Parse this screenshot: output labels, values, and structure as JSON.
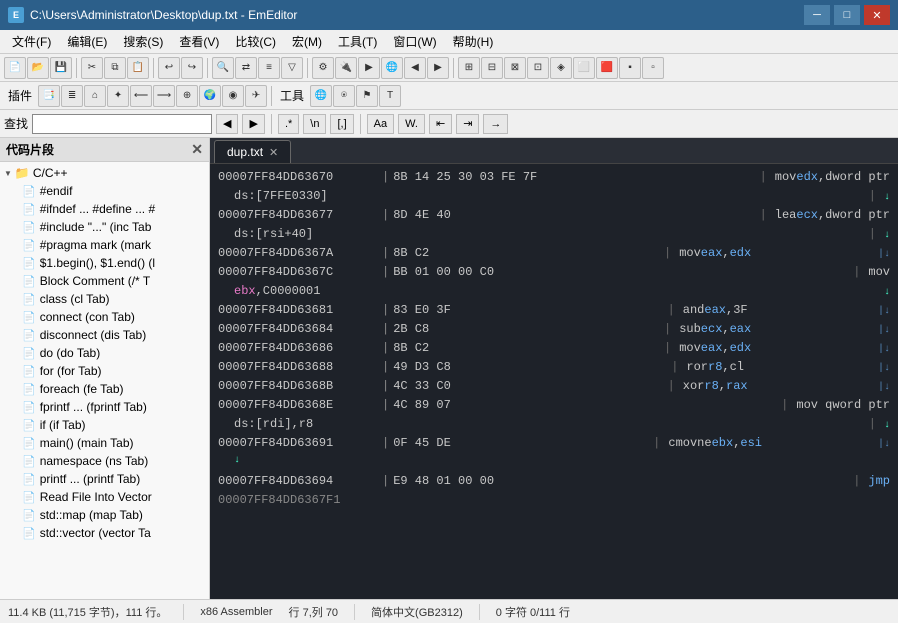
{
  "titlebar": {
    "title": "C:\\Users\\Administrator\\Desktop\\dup.txt - EmEditor",
    "icon_label": "E",
    "minimize_label": "─",
    "maximize_label": "□",
    "close_label": "✕"
  },
  "menubar": {
    "items": [
      "文件(F)",
      "编辑(E)",
      "搜索(S)",
      "查看(V)",
      "比较(C)",
      "宏(M)",
      "工具(T)",
      "窗口(W)",
      "帮助(H)"
    ]
  },
  "find_bar": {
    "label": "查找",
    "placeholder": ""
  },
  "sidebar": {
    "title": "代码片段",
    "tree_root_label": "C/C++",
    "items": [
      "#endif",
      "#ifndef ... #define ... #",
      "#include \"...\" (inc Tab",
      "#pragma mark (mark",
      "$1.begin(), $1.end() (l",
      "Block Comment (/* T",
      "class (cl Tab)",
      "connect (con Tab)",
      "disconnect (dis Tab)",
      "do (do Tab)",
      "for (for Tab)",
      "foreach (fe Tab)",
      "fprintf ... (fprintf Tab)",
      "if (if Tab)",
      "main() (main Tab)",
      "namespace (ns Tab)",
      "printf ... (printf Tab)",
      "Read File Into Vector",
      "std::map (map Tab)",
      "std::vector (vector Ta"
    ]
  },
  "editor": {
    "tab_name": "dup.txt",
    "lines": [
      {
        "addr": "00007FF84DD63670",
        "bytes": "8B 14 25 30 03 FE 7F",
        "spaces": "            ",
        "pipe": "|",
        "mnemonic": " mov ",
        "reg1": "edx",
        "op": ",dword ptr",
        "indent": ""
      },
      {
        "addr": "ds:[7FFE0330]",
        "bytes": "",
        "spaces": "",
        "pipe": "|↓",
        "mnemonic": "",
        "reg1": "",
        "op": "",
        "indent": ""
      },
      {
        "addr": "00007FF84DD63677",
        "bytes": "8D 4E 40",
        "spaces": "                   ",
        "pipe": "|",
        "mnemonic": " lea ",
        "reg1": "ecx",
        "op": ",dword ptr",
        "indent": ""
      },
      {
        "addr": "ds:[rsi+40]",
        "bytes": "",
        "spaces": "        ",
        "pipe": "|↓",
        "mnemonic": "",
        "reg1": "",
        "op": "",
        "indent": ""
      },
      {
        "addr": "00007FF84DD6367A",
        "bytes": "8B C2",
        "spaces": "                     ",
        "pipe": "|",
        "mnemonic": " mov ",
        "reg1": "eax",
        "op": ",",
        "reg2": "edx",
        "indent": ""
      },
      {
        "addr": "00007FF84DD6367C",
        "bytes": "BB 01 00 00 C0",
        "spaces": "               ",
        "pipe": "|",
        "mnemonic": " mov",
        "reg1": "",
        "op": "",
        "indent": ""
      },
      {
        "addr": "ebx,C0000001",
        "bytes": "",
        "spaces": "               ",
        "pipe": "↓",
        "mnemonic": "",
        "reg1": "",
        "op": "",
        "indent": ""
      },
      {
        "addr": "00007FF84DD63681",
        "bytes": "83 E0 3F",
        "spaces": "                 ",
        "pipe": "|",
        "mnemonic": " and ",
        "reg1": "eax",
        "op": ",3F",
        "indent": ""
      },
      {
        "addr": "00007FF84DD63684",
        "bytes": "2B C8",
        "spaces": "                     ",
        "pipe": "|",
        "mnemonic": " sub ",
        "reg1": "ecx",
        "op": ",",
        "reg2": "eax",
        "indent": ""
      },
      {
        "addr": "00007FF84DD63686",
        "bytes": "8B C2",
        "spaces": "                     ",
        "pipe": "|",
        "mnemonic": " mov ",
        "reg1": "eax",
        "op": ",",
        "reg2": "edx",
        "indent": ""
      },
      {
        "addr": "00007FF84DD63688",
        "bytes": "49 D3 C8",
        "spaces": "                 ",
        "pipe": "|",
        "mnemonic": " ror ",
        "reg1": "r8",
        "op": ",cl",
        "indent": ""
      },
      {
        "addr": "00007FF84DD6368B",
        "bytes": "4C 33 C0",
        "spaces": "                 ",
        "pipe": "|",
        "mnemonic": " xor ",
        "reg1": "r8",
        "op": ",",
        "reg2": "rax",
        "indent": ""
      },
      {
        "addr": "00007FF84DD6368E",
        "bytes": "4C 89 07",
        "spaces": "                 ",
        "pipe": "|",
        "mnemonic": " mov qword ptr",
        "reg1": "",
        "op": "",
        "indent": ""
      },
      {
        "addr": "ds:[rdi],r8",
        "bytes": "",
        "spaces": "       ",
        "pipe": "|↓",
        "mnemonic": "",
        "reg1": "",
        "op": "",
        "indent": ""
      },
      {
        "addr": "00007FF84DD63691",
        "bytes": "0F 45 DE",
        "spaces": "                 ",
        "pipe": "|",
        "mnemonic": " cmovne ",
        "reg1": "ebx",
        "op": ",",
        "reg2": "esi",
        "indent": ""
      },
      {
        "addr": "↓",
        "bytes": "",
        "spaces": "",
        "pipe": "",
        "mnemonic": "",
        "reg1": "",
        "op": "",
        "indent": ""
      },
      {
        "addr": "00007FF84DD63694",
        "bytes": "E9 48 01 00 00",
        "spaces": "           ",
        "pipe": "|",
        "mnemonic": " jmp",
        "reg1": "",
        "op": "",
        "indent": ""
      }
    ]
  },
  "statusbar": {
    "file_size": "11.4 KB (11,715 字节)，111 行。",
    "asm_mode": "x86 Assembler",
    "row_col": "行 7,列 70",
    "encoding": "简体中文(GB2312)",
    "selection": "0 字符 0/111 行"
  }
}
